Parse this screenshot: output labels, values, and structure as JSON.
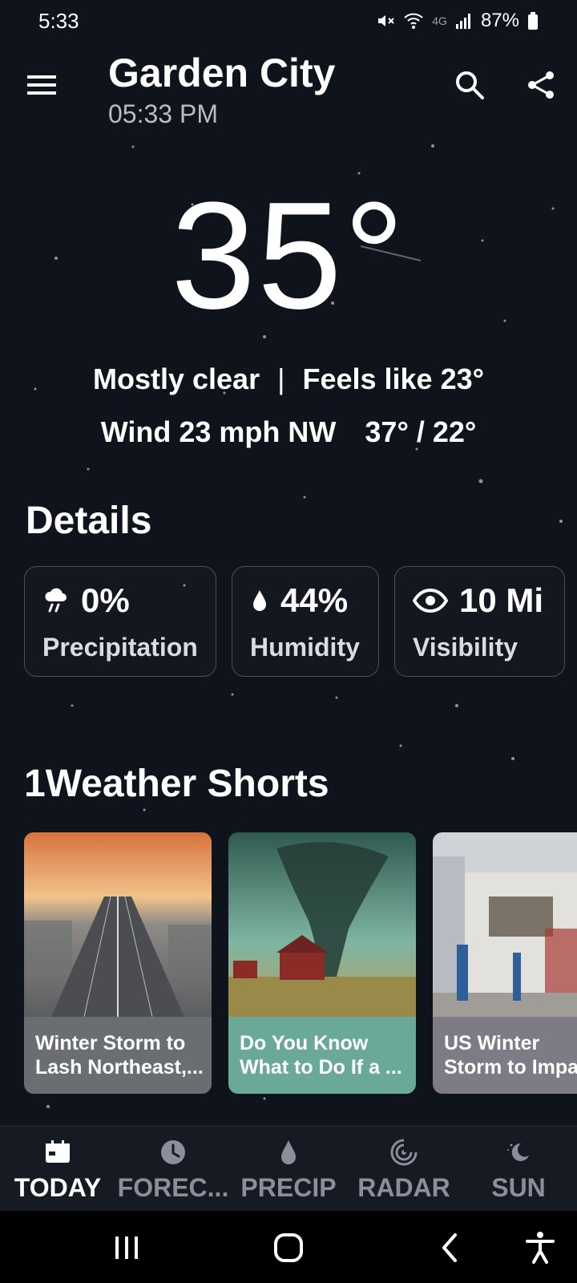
{
  "status_bar": {
    "time": "5:33",
    "network": "4G",
    "battery": "87%",
    "icons": [
      "mute-icon",
      "wifi-icon",
      "signal-icon",
      "battery-icon"
    ]
  },
  "header": {
    "city": "Garden City",
    "time": "05:33 PM",
    "icons": [
      "menu-icon",
      "search-icon",
      "share-icon"
    ]
  },
  "current": {
    "temperature": "35°",
    "condition": "Mostly clear",
    "separator": "|",
    "feels_like": "Feels like 23°",
    "wind": "Wind 23 mph NW",
    "hi_lo": "37° / 22°"
  },
  "details": {
    "title": "Details",
    "cards": [
      {
        "value": "0%",
        "label": "Precipitation",
        "icon": "rain-cloud-icon"
      },
      {
        "value": "44%",
        "label": "Humidity",
        "icon": "droplet-icon"
      },
      {
        "value": "10 Mi",
        "label": "Visibility",
        "icon": "eye-icon"
      }
    ]
  },
  "shorts": {
    "title": "1Weather Shorts",
    "items": [
      {
        "caption_line1": "Winter Storm to",
        "caption_line2": "Lash Northeast,...",
        "color": "#6a6e73"
      },
      {
        "caption_line1": "Do You Know",
        "caption_line2": "What to Do If a ...",
        "color": "#6aa898"
      },
      {
        "caption_line1": "US Winter",
        "caption_line2": "Storm to Impa",
        "color": "#7e7b86"
      }
    ]
  },
  "bottom_nav": {
    "items": [
      {
        "label": "TODAY",
        "icon": "calendar-icon",
        "active": true
      },
      {
        "label": "FOREC...",
        "icon": "clock-icon",
        "active": false
      },
      {
        "label": "PRECIP",
        "icon": "droplet-icon",
        "active": false
      },
      {
        "label": "RADAR",
        "icon": "radar-icon",
        "active": false
      },
      {
        "label": "SUN",
        "icon": "moon-icon",
        "active": false
      }
    ]
  },
  "system_nav": {
    "icons": [
      "recents-icon",
      "home-icon",
      "back-icon",
      "accessibility-icon"
    ]
  },
  "colors": {
    "background": "#0f131b",
    "card_border": "#4a4f59",
    "inactive_nav": "#8a8f99",
    "active_nav": "#ffffff"
  }
}
